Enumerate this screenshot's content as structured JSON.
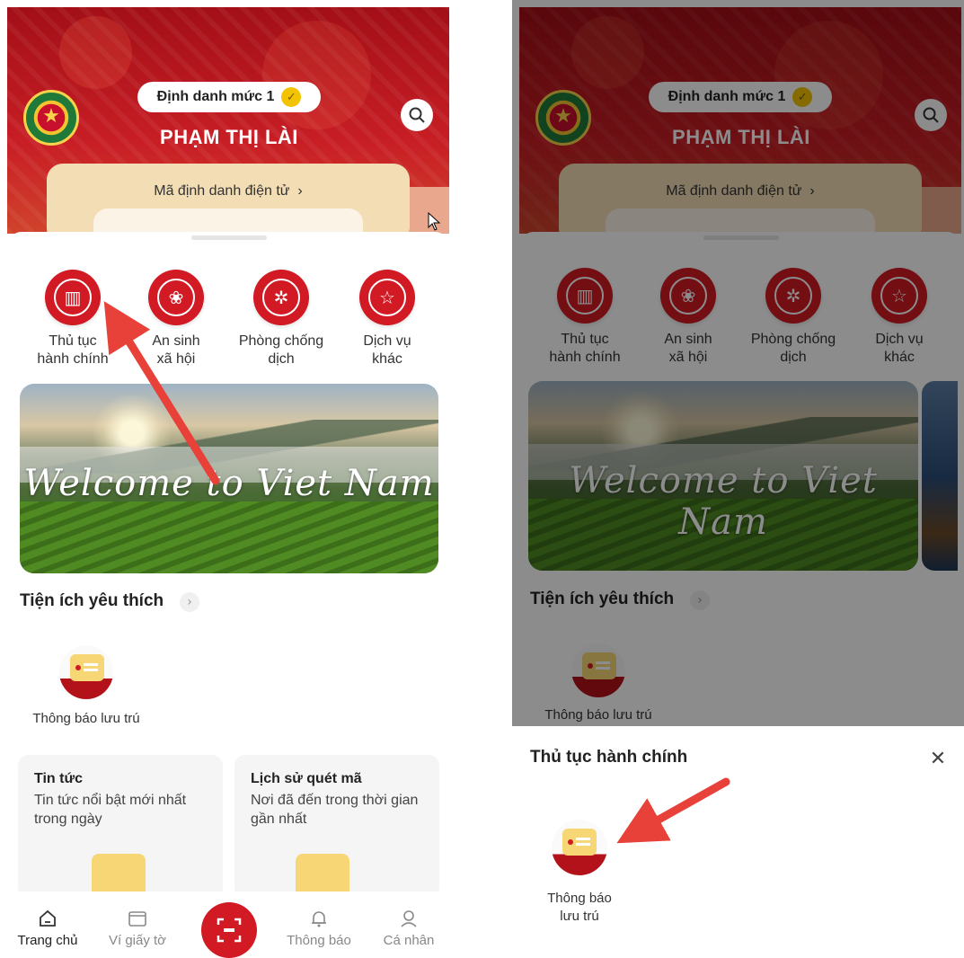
{
  "left": {
    "header": {
      "level_badge": "Định danh mức 1",
      "user_name": "PHẠM THỊ LÀI",
      "id_card_label": "Mã định danh điện tử",
      "id_card_chevron": "›"
    },
    "services": [
      {
        "label": "Thủ tục\nhành chính",
        "icon": "building-icon"
      },
      {
        "label": "An sinh\nxã hội",
        "icon": "family-icon"
      },
      {
        "label": "Phòng chống\ndịch",
        "icon": "virus-shield-icon"
      },
      {
        "label": "Dịch vụ\nkhác",
        "icon": "star-badge-icon"
      }
    ],
    "banner_text": "Welcome to Viet Nam",
    "favorites": {
      "title": "Tiện ích yêu thích",
      "chevron": "›",
      "items": [
        {
          "label": "Thông báo lưu trú"
        }
      ]
    },
    "cards": [
      {
        "title": "Tin tức",
        "desc": "Tin tức nổi bật mới nhất trong ngày"
      },
      {
        "title": "Lịch sử quét mã",
        "desc": "Nơi đã đến trong thời gian gần nhất"
      }
    ],
    "nav": [
      {
        "label": "Trang chủ"
      },
      {
        "label": "Ví giấy tờ"
      },
      {
        "label": "Thông báo"
      },
      {
        "label": "Cá nhân"
      }
    ]
  },
  "right": {
    "header": {
      "level_badge": "Định danh mức 1",
      "user_name": "PHẠM THỊ LÀI",
      "id_card_label": "Mã định danh điện tử",
      "id_card_chevron": "›"
    },
    "services": [
      {
        "label": "Thủ tục\nhành chính"
      },
      {
        "label": "An sinh\nxã hội"
      },
      {
        "label": "Phòng chống\ndịch"
      },
      {
        "label": "Dịch vụ\nkhác"
      }
    ],
    "banner_text": "Welcome to Viet Nam",
    "favorites": {
      "title": "Tiện ích yêu thích",
      "chevron": "›",
      "items": [
        {
          "label": "Thông báo lưu trú"
        }
      ]
    },
    "sheet": {
      "title": "Thủ tục hành chính",
      "close": "✕",
      "items": [
        {
          "label": "Thông báo\nlưu trú"
        }
      ]
    }
  },
  "colors": {
    "brand_red": "#d11a24",
    "header_red": "#b5121b",
    "annotation_arrow": "#e8413a"
  }
}
